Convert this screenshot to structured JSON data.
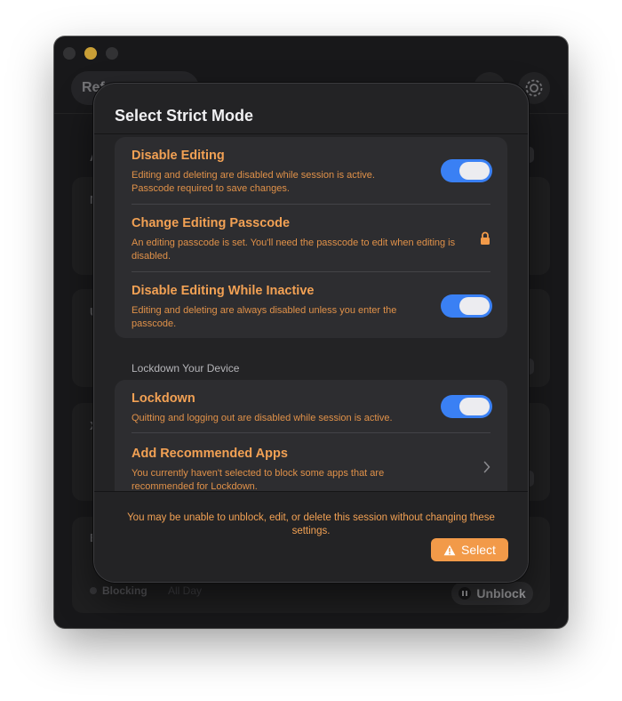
{
  "window": {
    "search_text": "Ref",
    "bg_letters": [
      "A",
      "N",
      "U",
      "X",
      "B"
    ],
    "bg_status": "Blocking",
    "bg_schedule": "All Day",
    "bg_unblock_label": "Unblock"
  },
  "sheet": {
    "title": "Select Strict Mode",
    "editing_group": [
      {
        "title": "Disable Editing",
        "description": "Editing and deleting are disabled while session is active. Passcode required to save changes.",
        "control": "toggle",
        "on": true
      },
      {
        "title": "Change Editing Passcode",
        "description": "An editing passcode is set. You'll need the passcode to edit when editing is disabled.",
        "control": "lock-icon"
      },
      {
        "title": "Disable Editing While Inactive",
        "description": "Editing and deleting are always disabled unless you enter the passcode.",
        "control": "toggle",
        "on": true
      }
    ],
    "lockdown_section_label": "Lockdown Your Device",
    "lockdown_group": [
      {
        "title": "Lockdown",
        "description": "Quitting and logging out are disabled while session is active.",
        "control": "toggle",
        "on": true
      },
      {
        "title": "Add Recommended Apps",
        "description": "You currently haven't selected to block some apps that are recommended for Lockdown.",
        "control": "chevron-right-icon"
      }
    ],
    "footer_warning": "You may be unable to unblock, edit, or delete this session without changing these settings.",
    "select_label": "Select"
  },
  "colors": {
    "accent_orange": "#f2a154",
    "toggle_blue": "#3a80f4",
    "button_orange": "#f29a49"
  }
}
